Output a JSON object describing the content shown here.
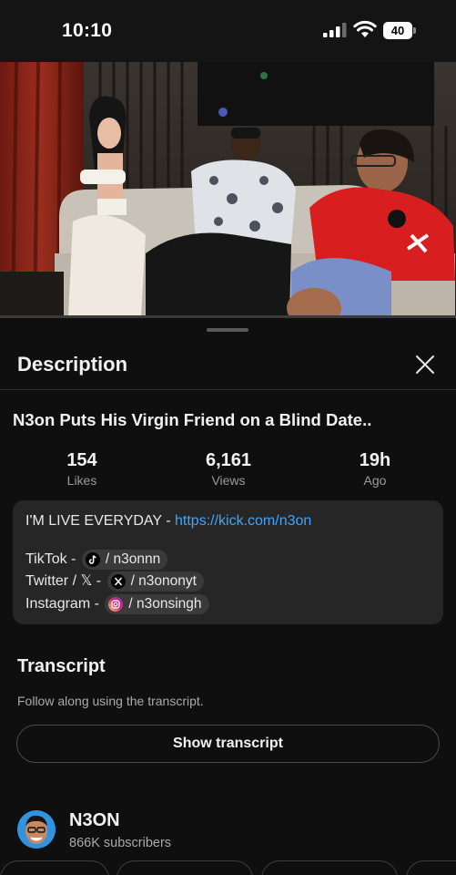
{
  "status_bar": {
    "time": "10:10",
    "battery_level": "40"
  },
  "video": {
    "progress_fraction": 0.0
  },
  "sheet": {
    "title": "Description",
    "close_icon": "close-icon"
  },
  "video_info": {
    "title": "N3on Puts His Virgin Friend on a Blind Date..",
    "stats": [
      {
        "value": "154",
        "label": "Likes"
      },
      {
        "value": "6,161",
        "label": "Views"
      },
      {
        "value": "19h",
        "label": "Ago"
      }
    ]
  },
  "description": {
    "live_text": "I'M LIVE EVERYDAY - ",
    "live_link": "https://kick.com/n3on",
    "socials": [
      {
        "label": "TikTok - ",
        "icon": "tiktok-icon",
        "handle": "/ n3onnn"
      },
      {
        "label": "Twitter / 𝕏 - ",
        "icon": "x-icon",
        "handle": "/ n3ononyt"
      },
      {
        "label": "Instagram - ",
        "icon": "instagram-icon",
        "handle": "/ n3onsingh"
      }
    ]
  },
  "transcript": {
    "title": "Transcript",
    "subtitle": "Follow along using the transcript.",
    "button_label": "Show transcript"
  },
  "channel": {
    "name": "N3ON",
    "subscribers": "866K subscribers"
  },
  "colors": {
    "background": "#0f0f0f",
    "card": "#262626",
    "link": "#3ea6ff",
    "instagram": "#d62976"
  }
}
